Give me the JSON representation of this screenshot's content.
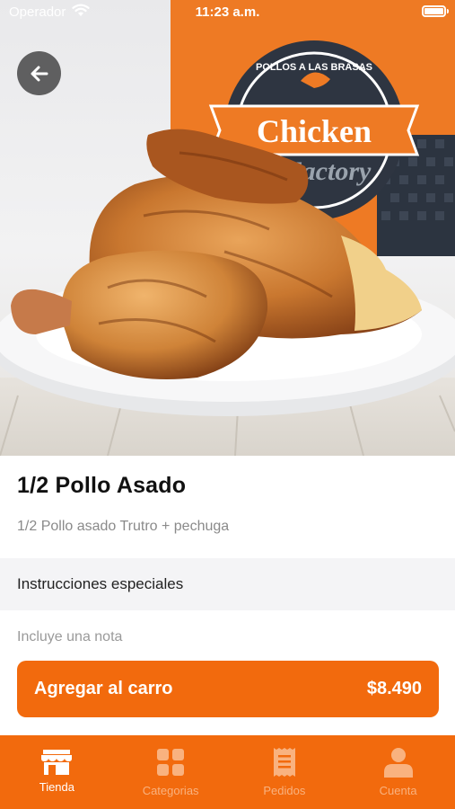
{
  "status_bar": {
    "carrier": "Operador",
    "time": "11:23 a.m."
  },
  "hero": {
    "box_text": "Chicken",
    "box_text_2": "Factory",
    "box_small_text": "POLLOS A LAS BRASAS"
  },
  "product": {
    "title": "1/2 Pollo Asado",
    "description": "1/2 Pollo asado Trutro + pechuga"
  },
  "instructions": {
    "label": "Instrucciones especiales",
    "placeholder": "Incluye una nota",
    "value": ""
  },
  "cart": {
    "button_label": "Agregar al carro",
    "price": "$8.490"
  },
  "tabs": [
    {
      "label": "Tienda",
      "icon": "store-icon",
      "active": true
    },
    {
      "label": "Categorias",
      "icon": "grid-icon",
      "active": false
    },
    {
      "label": "Pedidos",
      "icon": "receipt-icon",
      "active": false
    },
    {
      "label": "Cuenta",
      "icon": "person-icon",
      "active": false
    }
  ],
  "colors": {
    "accent": "#f26a0d",
    "tab_inactive": "#f9b27f"
  }
}
